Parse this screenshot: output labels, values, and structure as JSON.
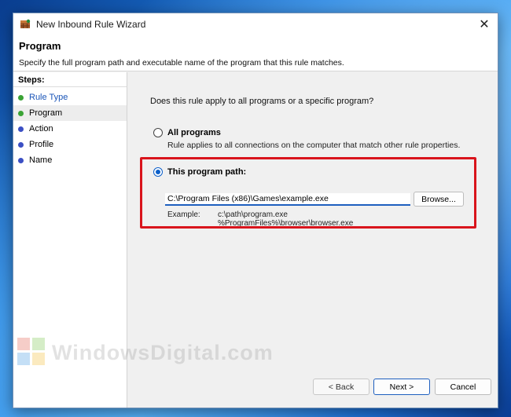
{
  "window": {
    "title": "New Inbound Rule Wizard",
    "close_glyph": "✕"
  },
  "header": {
    "title": "Program",
    "description": "Specify the full program path and executable name of the program that this rule matches."
  },
  "steps": {
    "heading": "Steps:",
    "items": [
      {
        "label": "Rule Type",
        "state": "completed",
        "dot_color": "#3aa335"
      },
      {
        "label": "Program",
        "state": "current",
        "dot_color": "#3aa335"
      },
      {
        "label": "Action",
        "state": "pending",
        "dot_color": "#3b4fc4"
      },
      {
        "label": "Profile",
        "state": "pending",
        "dot_color": "#3b4fc4"
      },
      {
        "label": "Name",
        "state": "pending",
        "dot_color": "#3b4fc4"
      }
    ]
  },
  "main": {
    "question": "Does this rule apply to all programs or a specific program?",
    "option_all": {
      "label": "All programs",
      "description": "Rule applies to all connections on the computer that match other rule properties.",
      "selected": false
    },
    "option_path": {
      "label": "This program path:",
      "selected": true,
      "value": "C:\\Program Files (x86)\\Games\\example.exe",
      "browse_label": "Browse...",
      "example_label": "Example:",
      "example_lines": [
        "c:\\path\\program.exe",
        "%ProgramFiles%\\browser\\browser.exe"
      ]
    }
  },
  "footer": {
    "back_label": "< Back",
    "next_label": "Next >",
    "cancel_label": "Cancel"
  },
  "watermark": {
    "text": "WindowsDigital.com"
  },
  "colors": {
    "accent": "#1e5fbf",
    "highlight": "#d9141c",
    "step_done": "#3aa335",
    "step_pending": "#3b4fc4"
  }
}
